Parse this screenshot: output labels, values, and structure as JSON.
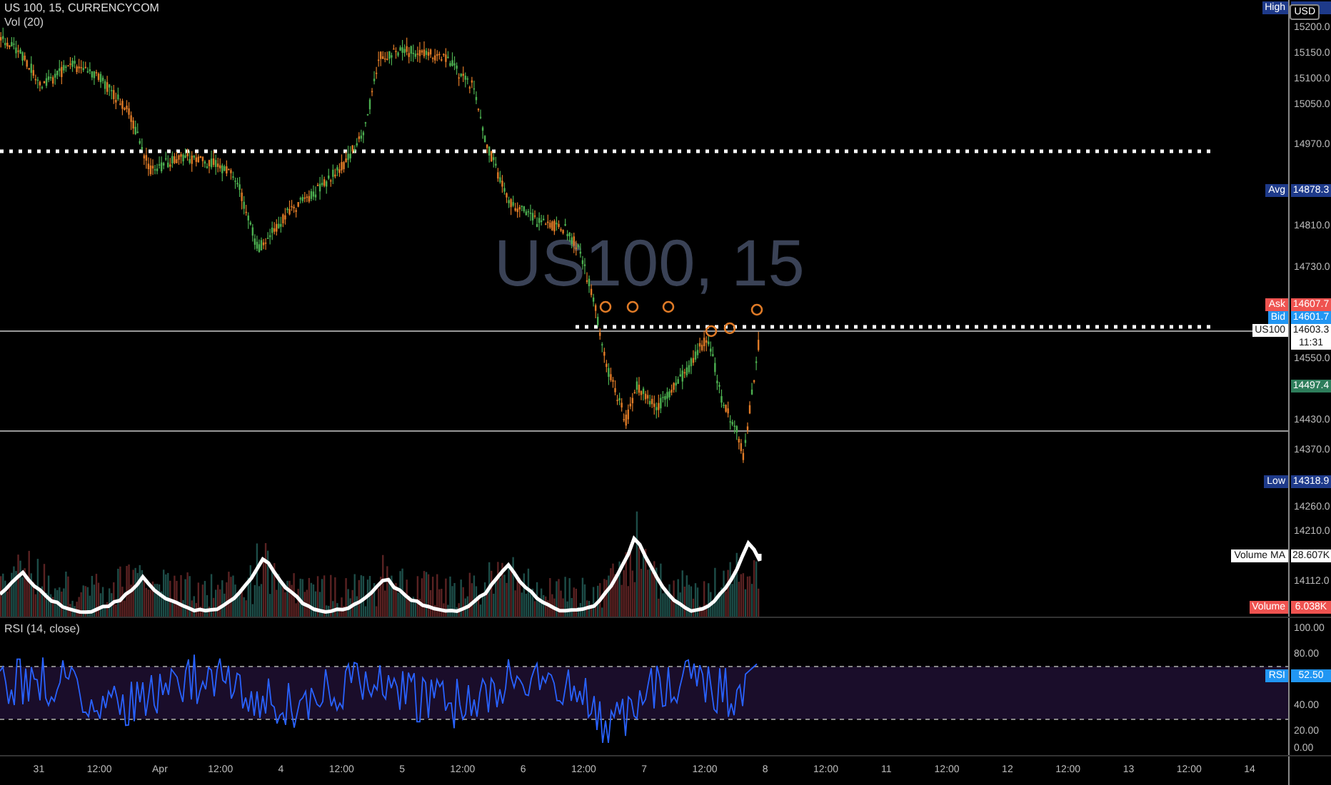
{
  "legend": {
    "symbol": "US 100, 15, CURRENCYCOM",
    "study": "Vol (20)"
  },
  "symbol_watermark": {
    "title": "US100, 15"
  },
  "price_axis": {
    "currency": "USD",
    "ticks": [
      "15200.0",
      "15150.0",
      "15100.0",
      "15050.0",
      "14970.0",
      "14810.0",
      "14730.0",
      "14550.0",
      "14430.0",
      "14370.0",
      "14260.0",
      "14210.0",
      "14112.0"
    ]
  },
  "badges": [
    {
      "label": "High",
      "color": "#1e3a8a"
    },
    {
      "label": "Avg",
      "value": "14878.3",
      "color": "#1e3a8a"
    },
    {
      "label": "Ask",
      "value": "14607.7",
      "color": "#ef5350"
    },
    {
      "label": "Bid",
      "value": "14601.7",
      "color": "#2196f3"
    },
    {
      "label": "US100",
      "value": "14603.3",
      "countdown": "11:31",
      "color": "#ffffff"
    },
    {
      "value": "14497.4",
      "color": "#2e7d5b"
    },
    {
      "label": "Low",
      "value": "14318.9",
      "color": "#1e3a8a"
    },
    {
      "label": "Volume MA",
      "value": "28.607K",
      "color": "#ffffff"
    },
    {
      "label": "Volume",
      "value": "6.038K",
      "color": "#ef5350"
    }
  ],
  "rsi": {
    "title": "RSI (14, close)",
    "ticks": [
      "100.00",
      "80.00",
      "40.00",
      "20.00",
      "0.00"
    ],
    "badge": {
      "label": "RSI",
      "value": "52.50",
      "color": "#2196f3"
    }
  },
  "time_axis": [
    "31",
    "12:00",
    "Apr",
    "12:00",
    "4",
    "12:00",
    "5",
    "12:00",
    "6",
    "12:00",
    "7",
    "12:00",
    "8",
    "12:00",
    "11",
    "12:00",
    "12",
    "12:00",
    "13",
    "12:00",
    "14"
  ]
}
